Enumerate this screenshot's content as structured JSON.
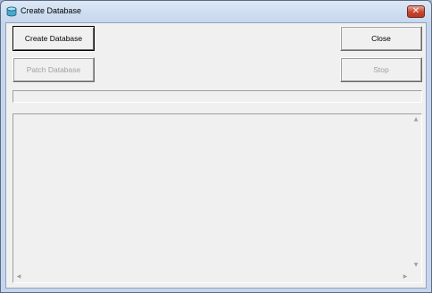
{
  "window": {
    "title": "Create Database",
    "close_glyph": "✕"
  },
  "buttons": {
    "create": "Create Database",
    "close": "Close",
    "patch": "Patch Database",
    "stop": "Stop"
  },
  "progress": {
    "value": 0
  },
  "log": {
    "text": ""
  },
  "scrollbar": {
    "up": "▲",
    "down": "▼",
    "left": "◀",
    "right": "▶"
  }
}
